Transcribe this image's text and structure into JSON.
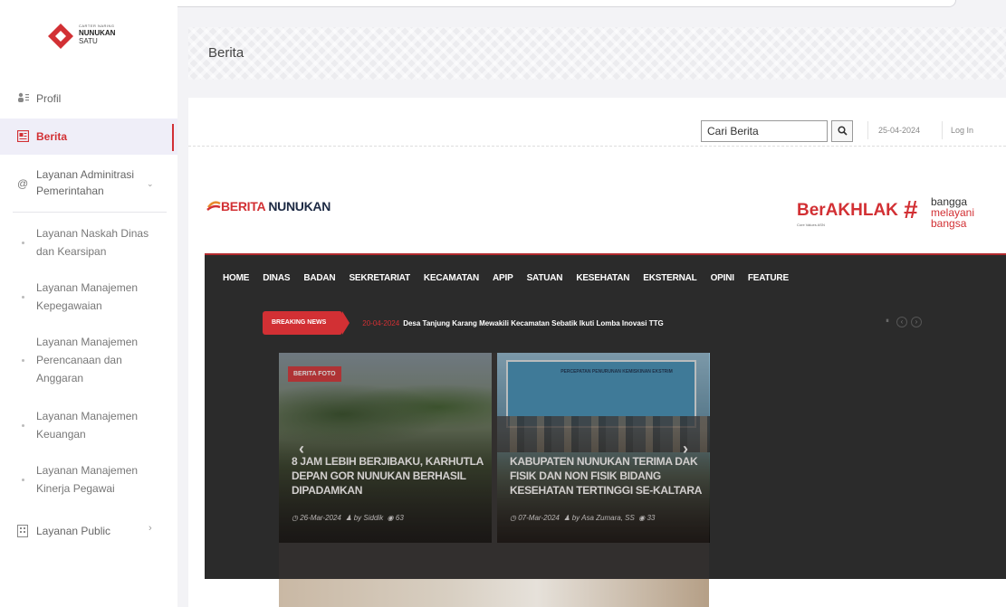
{
  "sidebar": {
    "logo": {
      "small": "CARTER NARING",
      "main": "NUNUKAN",
      "sub": "SATU"
    },
    "items": [
      {
        "label": "Profil",
        "icon": "users-icon"
      },
      {
        "label": "Berita",
        "icon": "newspaper-icon"
      },
      {
        "label": "Layanan Adminitrasi Pemerintahan",
        "icon": "at-icon"
      },
      {
        "label": "Layanan Naskah Dinas dan Kearsipan"
      },
      {
        "label": "Layanan Manajemen Kepegawaian"
      },
      {
        "label": "Layanan Manajemen Perencanaan dan Anggaran"
      },
      {
        "label": "Layanan Manajemen Keuangan"
      },
      {
        "label": "Layanan Manajemen Kinerja Pegawai"
      },
      {
        "label": "Layanan Public",
        "icon": "building-icon"
      }
    ],
    "accent": "#d23034"
  },
  "header": {
    "title": "Berita"
  },
  "utility": {
    "search_placeholder": "Cari Berita",
    "date": "25-04-2024",
    "login": "Log In"
  },
  "brand": {
    "logo_prefix": "BERITA",
    "logo_suffix": "NUNUKAN",
    "berakhlak": "BerAKHLAK",
    "berakhlak_sub": "Core Values ASN",
    "bangga": "bangga",
    "melayani": "melayani",
    "bangsa": "bangsa"
  },
  "menu": [
    "HOME",
    "DINAS",
    "BADAN",
    "SEKRETARIAT",
    "KECAMATAN",
    "APIP",
    "SATUAN",
    "KESEHATAN",
    "EKSTERNAL",
    "OPINI",
    "FEATURE"
  ],
  "breaking": {
    "tag": "BREAKING NEWS",
    "date": "20-04-2024",
    "text": "Desa Tanjung Karang Mewakili Kecamatan Sebatik Ikuti Lomba Inovasi TTG"
  },
  "slides": [
    {
      "tag": "BERITA FOTO",
      "title": "8 JAM LEBIH BERJIBAKU, KARHUTLA DEPAN GOR NUNUKAN BERHASIL DIPADAMKAN",
      "date": "26-Mar-2024",
      "author": "by Siddik",
      "views": "63"
    },
    {
      "title": "KABUPATEN NUNUKAN TERIMA DAK FISIK DAN NON FISIK BIDANG KESEHATAN TERTINGGI SE-KALTARA",
      "date": "07-Mar-2024",
      "author": "by Asa Zumara, SS",
      "views": "33",
      "banner": "PERCEPATAN PENURUNAN KEMISKINAN EKSTRIM"
    }
  ],
  "slider_prev": "‹",
  "slider_next": "›"
}
